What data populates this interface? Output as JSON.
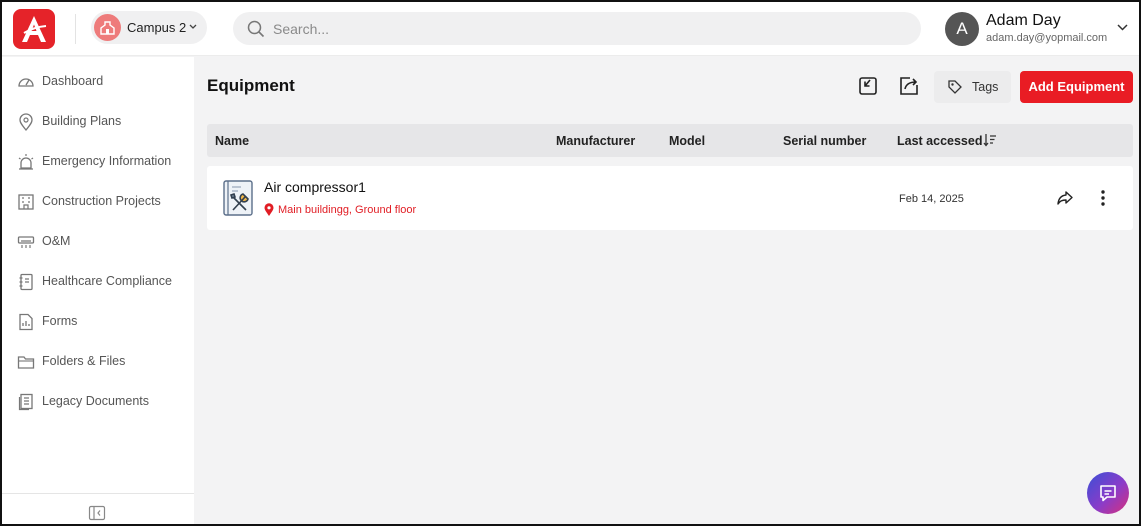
{
  "header": {
    "campus_label": "Campus 2",
    "search_placeholder": "Search...",
    "user": {
      "initial": "A",
      "name": "Adam Day",
      "email": "adam.day@yopmail.com"
    }
  },
  "sidebar": {
    "items": [
      {
        "label": "Dashboard",
        "icon": "gauge-icon"
      },
      {
        "label": "Building Plans",
        "icon": "map-pin-icon"
      },
      {
        "label": "Emergency Information",
        "icon": "alarm-light-icon"
      },
      {
        "label": "Construction Projects",
        "icon": "building-icon"
      },
      {
        "label": "O&M",
        "icon": "air-conditioner-icon"
      },
      {
        "label": "Healthcare Compliance",
        "icon": "notebook-icon"
      },
      {
        "label": "Forms",
        "icon": "form-icon"
      },
      {
        "label": "Folders & Files",
        "icon": "folder-icon"
      },
      {
        "label": "Legacy Documents",
        "icon": "documents-icon"
      }
    ]
  },
  "main": {
    "title": "Equipment",
    "tags_label": "Tags",
    "add_label": "Add Equipment",
    "columns": {
      "name": "Name",
      "manufacturer": "Manufacturer",
      "model": "Model",
      "serial": "Serial number",
      "last_accessed": "Last accessed"
    },
    "rows": [
      {
        "name": "Air compressor1",
        "location": "Main buildingg, Ground floor",
        "manufacturer": "",
        "model": "",
        "serial": "",
        "last_accessed": "Feb 14, 2025"
      }
    ]
  },
  "colors": {
    "brand_red": "#e91c24",
    "location_red": "#e11d24",
    "campus_icon": "#ee7b7b"
  }
}
